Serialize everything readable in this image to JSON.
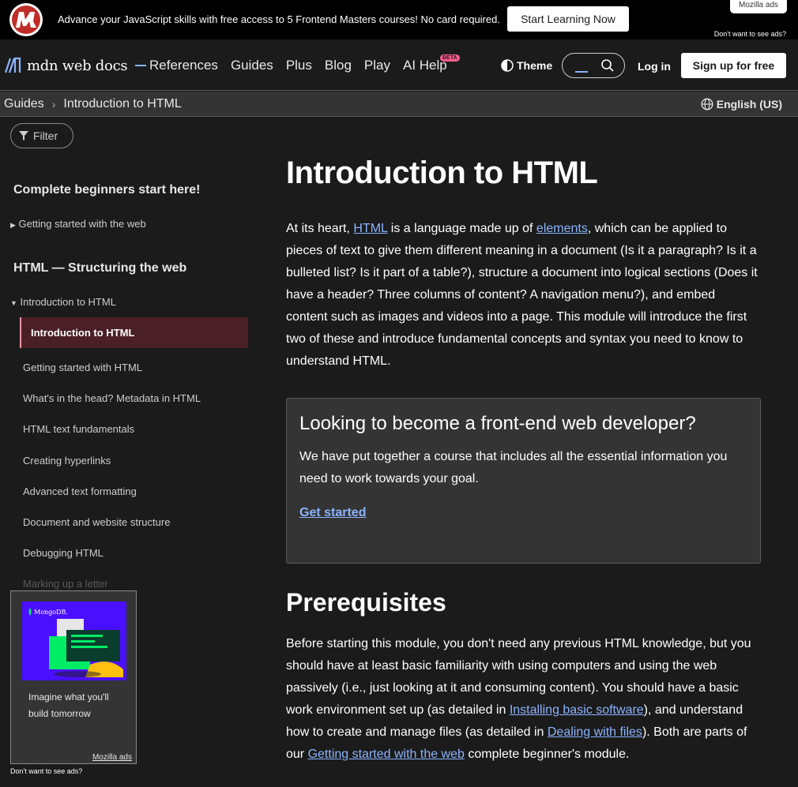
{
  "ad_banner": {
    "text": "Advance your JavaScript skills with free access to 5 Frontend Masters courses! No card required.",
    "button": "Start Learning Now",
    "mozilla_ads": "Mozilla ads",
    "dont_want": "Don't want to see ads?"
  },
  "nav": {
    "logo_text": "mdn web docs",
    "menu": [
      "References",
      "Guides",
      "Plus",
      "Blog",
      "Play",
      "AI Help"
    ],
    "beta": "BETA",
    "theme": "Theme",
    "login": "Log in",
    "signup": "Sign up for free"
  },
  "breadcrumb": {
    "items": [
      "Guides",
      "Introduction to HTML"
    ],
    "language": "English (US)"
  },
  "sidebar": {
    "filter": "Filter",
    "section1": "Complete beginners start here!",
    "getting_started_web": "Getting started with the web",
    "section2": "HTML — Structuring the web",
    "intro_group": "Introduction to HTML",
    "active": "Introduction to HTML",
    "items": [
      "Getting started with HTML",
      "What's in the head? Metadata in HTML",
      "HTML text fundamentals",
      "Creating hyperlinks",
      "Advanced text formatting",
      "Document and website structure",
      "Debugging HTML"
    ],
    "faded_item": "Marking up a letter",
    "ad": {
      "brand": "MongoDB.",
      "caption": "Imagine what you'll build tomorrow",
      "mozilla_ads": "Mozilla ads",
      "dont_want": "Don't want to see ads?"
    }
  },
  "main": {
    "title": "Introduction to HTML",
    "intro": {
      "p1": "At its heart, ",
      "link1": "HTML",
      "p2": " is a language made up of ",
      "link2": "elements",
      "p3": ", which can be applied to pieces of text to give them different meaning in a document (Is it a paragraph? Is it a bulleted list? Is it part of a table?), structure a document into logical sections (Does it have a header? Three columns of content? A navigation menu?), and embed content such as images and videos into a page. This module will introduce the first two of these and introduce fundamental concepts and syntax you need to know to understand HTML."
    },
    "callout": {
      "heading": "Looking to become a front-end web developer?",
      "body": "We have put together a course that includes all the essential information you need to work towards your goal.",
      "link": "Get started"
    },
    "prereq_heading": "Prerequisites",
    "prereq": {
      "p1": "Before starting this module, you don't need any previous HTML knowledge, but you should have at least basic familiarity with using computers and using the web passively (i.e., just looking at it and consuming content). You should have a basic work environment set up (as detailed in ",
      "link1": "Installing basic software",
      "p2": "), and understand how to create and manage files (as detailed in ",
      "link2": "Dealing with files",
      "p3": "). Both are parts of our ",
      "link3": "Getting started with the web",
      "p4": " complete beginner's module."
    }
  }
}
